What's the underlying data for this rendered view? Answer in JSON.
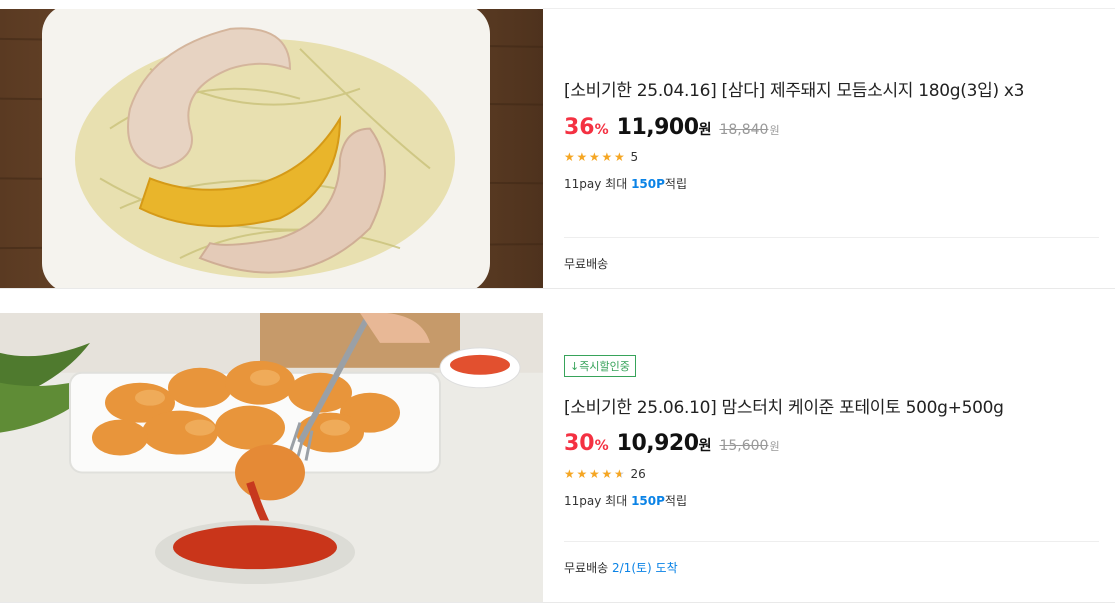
{
  "products": [
    {
      "title": "[소비기한 25.04.16] [삼다] 제주돼지 모듬소시지 180g(3입) x3",
      "discount_rate": "36",
      "rate_unit": "%",
      "price": "11,900",
      "price_unit": "원",
      "original_price": "18,840",
      "original_unit": "원",
      "rating_stars": 5,
      "review_count": "5",
      "pay_prefix": "11pay 최대",
      "pay_points": "150P",
      "pay_suffix": "적립",
      "shipping": "무료배송",
      "delivery_date": "",
      "badge": ""
    },
    {
      "title": "[소비기한 25.06.10] 맘스터치 케이준 포테이토 500g+500g",
      "discount_rate": "30",
      "rate_unit": "%",
      "price": "10,920",
      "price_unit": "원",
      "original_price": "15,600",
      "original_unit": "원",
      "rating_stars": 4.5,
      "review_count": "26",
      "pay_prefix": "11pay 최대",
      "pay_points": "150P",
      "pay_suffix": "적립",
      "shipping": "무료배송",
      "delivery_date": "2/1(토) 도착",
      "badge": "↓즉시할인중"
    }
  ],
  "colors": {
    "discount": "#f43142",
    "points": "#0b83e6",
    "badge": "#37a35a",
    "star": "#f5a623"
  }
}
